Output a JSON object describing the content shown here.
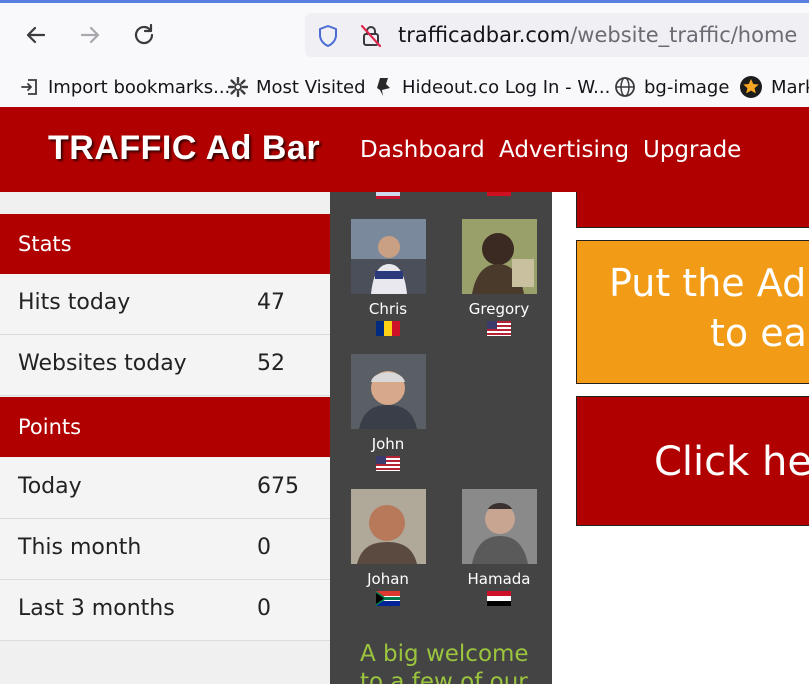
{
  "browser": {
    "url_host": "trafficadbar.com",
    "url_path": "/website_traffic/home",
    "bookmarks": [
      {
        "label": "Import bookmarks...",
        "icon": "import-icon"
      },
      {
        "label": "Most Visited",
        "icon": "gear-icon"
      },
      {
        "label": "Hideout.co Log In - W...",
        "icon": "hideout-icon"
      },
      {
        "label": "bg-image",
        "icon": "globe-icon"
      },
      {
        "label": "Mark",
        "icon": "star-badge-icon"
      }
    ]
  },
  "site": {
    "logo": "TRAFFIC Ad Bar",
    "nav": [
      "Dashboard",
      "Advertising",
      "Upgrade"
    ],
    "brand_color": "#b00000"
  },
  "stats": {
    "heading": "Stats",
    "rows": [
      {
        "label": "Hits today",
        "value": "47"
      },
      {
        "label": "Websites today",
        "value": "52"
      }
    ]
  },
  "points": {
    "heading": "Points",
    "rows": [
      {
        "label": "Today",
        "value": "675"
      },
      {
        "label": "This month",
        "value": "0"
      },
      {
        "label": "Last 3 months",
        "value": "0"
      }
    ]
  },
  "members": [
    {
      "name": "Chris",
      "flag": "romania"
    },
    {
      "name": "Gregory",
      "flag": "usa"
    },
    {
      "name": "John",
      "flag": "usa"
    },
    {
      "name": "Johan",
      "flag": "south-africa"
    },
    {
      "name": "Hamada",
      "flag": "egypt"
    }
  ],
  "welcome_text": "A big welcome to a few of our",
  "promo": {
    "box2_line1": "Put the Ad",
    "box2_line2": "to ear",
    "box3_text": "Click he"
  }
}
